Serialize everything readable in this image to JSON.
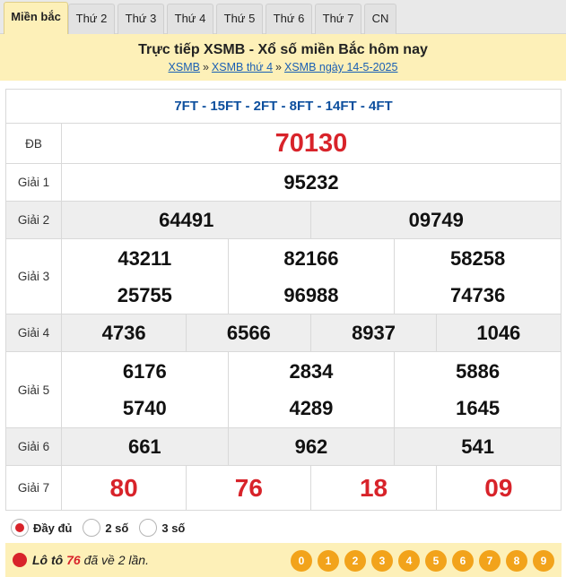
{
  "tabs": [
    "Miền bắc",
    "Thứ 2",
    "Thứ 3",
    "Thứ 4",
    "Thứ 5",
    "Thứ 6",
    "Thứ 7",
    "CN"
  ],
  "header": {
    "title": "Trực tiếp XSMB - Xổ số miền Bắc hôm nay",
    "crumb_1": "XSMB",
    "crumb_2": "XSMB thứ 4",
    "crumb_3": "XSMB ngày 14-5-2025",
    "separator": "»"
  },
  "codes": "7FT - 15FT - 2FT - 8FT - 14FT - 4FT",
  "prizes": {
    "db": {
      "label": "ĐB",
      "values": [
        "70130"
      ]
    },
    "g1": {
      "label": "Giải 1",
      "values": [
        "95232"
      ]
    },
    "g2": {
      "label": "Giải 2",
      "values": [
        "64491",
        "09749"
      ]
    },
    "g3": {
      "label": "Giải 3",
      "values": [
        "43211",
        "82166",
        "58258",
        "25755",
        "96988",
        "74736"
      ]
    },
    "g4": {
      "label": "Giải 4",
      "values": [
        "4736",
        "6566",
        "8937",
        "1046"
      ]
    },
    "g5": {
      "label": "Giải 5",
      "values": [
        "6176",
        "2834",
        "5886",
        "5740",
        "4289",
        "1645"
      ]
    },
    "g6": {
      "label": "Giải 6",
      "values": [
        "661",
        "962",
        "541"
      ]
    },
    "g7": {
      "label": "Giải 7",
      "values": [
        "80",
        "76",
        "18",
        "09"
      ]
    }
  },
  "options": {
    "full": "Đầy đủ",
    "two": "2 số",
    "three": "3 số",
    "selected": "full"
  },
  "loto": {
    "prefix": "Lô tô",
    "number": "76",
    "suffix": "đã về 2 lần.",
    "digits": [
      "0",
      "1",
      "2",
      "3",
      "4",
      "5",
      "6",
      "7",
      "8",
      "9"
    ]
  },
  "colors": {
    "accent_red": "#d8232a",
    "header_bg": "#fdf0b8",
    "link_blue": "#1a5fb4",
    "digit_orange": "#f2a31b"
  }
}
